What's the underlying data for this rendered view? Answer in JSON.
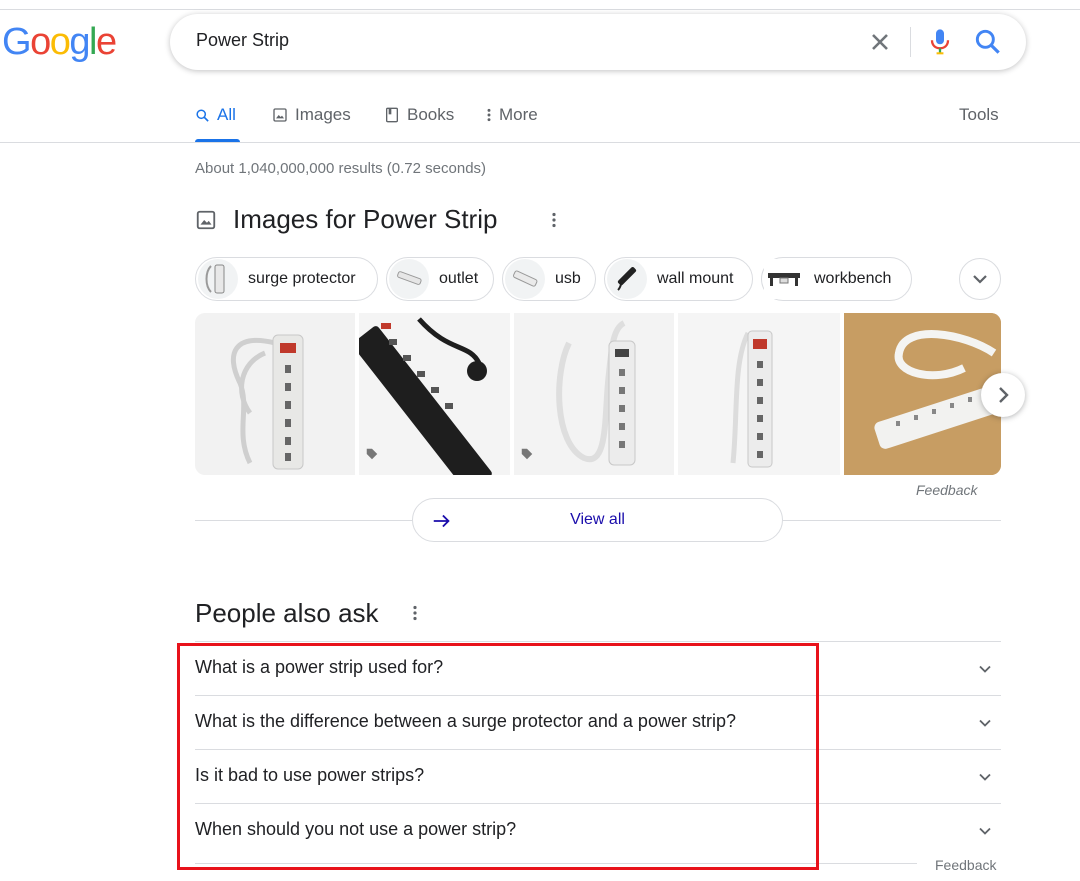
{
  "logo": {
    "letters": [
      "G",
      "o",
      "o",
      "g",
      "l",
      "e"
    ],
    "colors": [
      "#4285f4",
      "#ea4335",
      "#fbbc05",
      "#4285f4",
      "#34a853",
      "#ea4335"
    ]
  },
  "search": {
    "query": "Power Strip"
  },
  "tabs": [
    {
      "label": "All",
      "icon": "search-icon",
      "active": true
    },
    {
      "label": "Images",
      "icon": "image-icon"
    },
    {
      "label": "Books",
      "icon": "book-icon"
    },
    {
      "label": "More",
      "icon": "more-vert-icon"
    }
  ],
  "tools_label": "Tools",
  "stats": "About 1,040,000,000 results (0.72 seconds)",
  "images_section": {
    "title": "Images for Power Strip",
    "chips": [
      "surge protector",
      "outlet",
      "usb",
      "wall mount",
      "workbench"
    ],
    "feedback": "Feedback",
    "view_all": "View all"
  },
  "paa": {
    "title": "People also ask",
    "questions": [
      "What is a power strip used for?",
      "What is the difference between a surge protector and a power strip?",
      "Is it bad to use power strips?",
      "When should you not use a power strip?"
    ],
    "feedback": "Feedback"
  },
  "colors": {
    "accent": "#1a73e8",
    "link": "#1a0dab",
    "highlight": "#e8121b"
  }
}
